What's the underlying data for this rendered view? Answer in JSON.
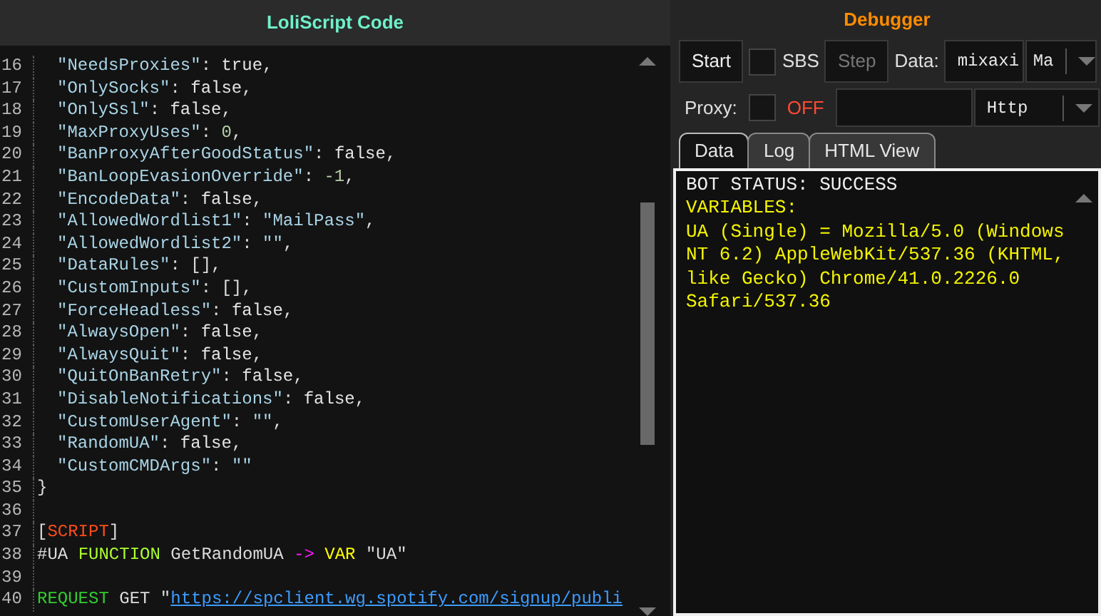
{
  "editor": {
    "title": "LoliScript Code",
    "lines": [
      {
        "number": "16",
        "indented": true,
        "tokens": [
          {
            "kind": "key",
            "text": "\"NeedsProxies\""
          },
          {
            "kind": "punct",
            "text": ": "
          },
          {
            "kind": "bool",
            "text": "true"
          },
          {
            "kind": "punct",
            "text": ","
          }
        ]
      },
      {
        "number": "17",
        "indented": true,
        "tokens": [
          {
            "kind": "key",
            "text": "\"OnlySocks\""
          },
          {
            "kind": "punct",
            "text": ": "
          },
          {
            "kind": "bool",
            "text": "false"
          },
          {
            "kind": "punct",
            "text": ","
          }
        ]
      },
      {
        "number": "18",
        "indented": true,
        "tokens": [
          {
            "kind": "key",
            "text": "\"OnlySsl\""
          },
          {
            "kind": "punct",
            "text": ": "
          },
          {
            "kind": "bool",
            "text": "false"
          },
          {
            "kind": "punct",
            "text": ","
          }
        ]
      },
      {
        "number": "19",
        "indented": true,
        "tokens": [
          {
            "kind": "key",
            "text": "\"MaxProxyUses\""
          },
          {
            "kind": "punct",
            "text": ": "
          },
          {
            "kind": "number",
            "text": "0"
          },
          {
            "kind": "punct",
            "text": ","
          }
        ]
      },
      {
        "number": "20",
        "indented": true,
        "tokens": [
          {
            "kind": "key",
            "text": "\"BanProxyAfterGoodStatus\""
          },
          {
            "kind": "punct",
            "text": ": "
          },
          {
            "kind": "bool",
            "text": "false"
          },
          {
            "kind": "punct",
            "text": ","
          }
        ]
      },
      {
        "number": "21",
        "indented": true,
        "tokens": [
          {
            "kind": "key",
            "text": "\"BanLoopEvasionOverride\""
          },
          {
            "kind": "punct",
            "text": ": "
          },
          {
            "kind": "number",
            "text": "-1"
          },
          {
            "kind": "punct",
            "text": ","
          }
        ]
      },
      {
        "number": "22",
        "indented": true,
        "tokens": [
          {
            "kind": "key",
            "text": "\"EncodeData\""
          },
          {
            "kind": "punct",
            "text": ": "
          },
          {
            "kind": "bool",
            "text": "false"
          },
          {
            "kind": "punct",
            "text": ","
          }
        ]
      },
      {
        "number": "23",
        "indented": true,
        "tokens": [
          {
            "kind": "key",
            "text": "\"AllowedWordlist1\""
          },
          {
            "kind": "punct",
            "text": ": "
          },
          {
            "kind": "key",
            "text": "\"MailPass\""
          },
          {
            "kind": "punct",
            "text": ","
          }
        ]
      },
      {
        "number": "24",
        "indented": true,
        "tokens": [
          {
            "kind": "key",
            "text": "\"AllowedWordlist2\""
          },
          {
            "kind": "punct",
            "text": ": "
          },
          {
            "kind": "key",
            "text": "\"\""
          },
          {
            "kind": "punct",
            "text": ","
          }
        ]
      },
      {
        "number": "25",
        "indented": true,
        "tokens": [
          {
            "kind": "key",
            "text": "\"DataRules\""
          },
          {
            "kind": "punct",
            "text": ": [],"
          }
        ]
      },
      {
        "number": "26",
        "indented": true,
        "tokens": [
          {
            "kind": "key",
            "text": "\"CustomInputs\""
          },
          {
            "kind": "punct",
            "text": ": [],"
          }
        ]
      },
      {
        "number": "27",
        "indented": true,
        "tokens": [
          {
            "kind": "key",
            "text": "\"ForceHeadless\""
          },
          {
            "kind": "punct",
            "text": ": "
          },
          {
            "kind": "bool",
            "text": "false"
          },
          {
            "kind": "punct",
            "text": ","
          }
        ]
      },
      {
        "number": "28",
        "indented": true,
        "tokens": [
          {
            "kind": "key",
            "text": "\"AlwaysOpen\""
          },
          {
            "kind": "punct",
            "text": ": "
          },
          {
            "kind": "bool",
            "text": "false"
          },
          {
            "kind": "punct",
            "text": ","
          }
        ]
      },
      {
        "number": "29",
        "indented": true,
        "tokens": [
          {
            "kind": "key",
            "text": "\"AlwaysQuit\""
          },
          {
            "kind": "punct",
            "text": ": "
          },
          {
            "kind": "bool",
            "text": "false"
          },
          {
            "kind": "punct",
            "text": ","
          }
        ]
      },
      {
        "number": "30",
        "indented": true,
        "tokens": [
          {
            "kind": "key",
            "text": "\"QuitOnBanRetry\""
          },
          {
            "kind": "punct",
            "text": ": "
          },
          {
            "kind": "bool",
            "text": "false"
          },
          {
            "kind": "punct",
            "text": ","
          }
        ]
      },
      {
        "number": "31",
        "indented": true,
        "tokens": [
          {
            "kind": "key",
            "text": "\"DisableNotifications\""
          },
          {
            "kind": "punct",
            "text": ": "
          },
          {
            "kind": "bool",
            "text": "false"
          },
          {
            "kind": "punct",
            "text": ","
          }
        ]
      },
      {
        "number": "32",
        "indented": true,
        "tokens": [
          {
            "kind": "key",
            "text": "\"CustomUserAgent\""
          },
          {
            "kind": "punct",
            "text": ": "
          },
          {
            "kind": "key",
            "text": "\"\""
          },
          {
            "kind": "punct",
            "text": ","
          }
        ]
      },
      {
        "number": "33",
        "indented": true,
        "tokens": [
          {
            "kind": "key",
            "text": "\"RandomUA\""
          },
          {
            "kind": "punct",
            "text": ": "
          },
          {
            "kind": "bool",
            "text": "false"
          },
          {
            "kind": "punct",
            "text": ","
          }
        ]
      },
      {
        "number": "34",
        "indented": true,
        "tokens": [
          {
            "kind": "key",
            "text": "\"CustomCMDArgs\""
          },
          {
            "kind": "punct",
            "text": ": "
          },
          {
            "kind": "key",
            "text": "\"\""
          }
        ]
      },
      {
        "number": "35",
        "indented": false,
        "tokens": [
          {
            "kind": "punct",
            "text": "}"
          }
        ]
      },
      {
        "number": "36",
        "indented": false
      },
      {
        "number": "37",
        "indented": false,
        "tokens": [
          {
            "kind": "punct",
            "text": "["
          },
          {
            "kind": "section",
            "text": "SCRIPT"
          },
          {
            "kind": "punct",
            "text": "]"
          }
        ]
      },
      {
        "number": "38",
        "indented": false,
        "tokens": [
          {
            "kind": "punct",
            "text": "#UA "
          },
          {
            "kind": "keyword",
            "text": "FUNCTION"
          },
          {
            "kind": "punct",
            "text": " GetRandomUA "
          },
          {
            "kind": "arrow",
            "text": "-> "
          },
          {
            "kind": "var",
            "text": "VAR"
          },
          {
            "kind": "punct",
            "text": " \"UA\""
          }
        ]
      },
      {
        "number": "39",
        "indented": false
      },
      {
        "number": "40",
        "indented": false,
        "tokens": [
          {
            "kind": "command",
            "text": "REQUEST"
          },
          {
            "kind": "punct",
            "text": " GET \""
          },
          {
            "kind": "url",
            "text": "https://spclient.wg.spotify.com/signup/publi"
          }
        ]
      }
    ]
  },
  "debugger": {
    "title": "Debugger",
    "start_button": "Start",
    "sbs": {
      "label": "SBS",
      "checked": false
    },
    "step_button": {
      "label": "Step",
      "disabled": true
    },
    "data_label": "Data:",
    "data_value": "mixaxi",
    "data_type": "Ma",
    "proxy": {
      "label": "Proxy:",
      "checked": false,
      "status": "OFF"
    },
    "proxy_type": "Http",
    "tabs": [
      {
        "label": "Data",
        "selected": true
      },
      {
        "label": "Log",
        "selected": false
      },
      {
        "label": "HTML View",
        "selected": false
      }
    ],
    "output": [
      {
        "kind": "status",
        "text": "BOT STATUS: SUCCESS"
      },
      {
        "kind": "variable",
        "text": "VARIABLES:"
      },
      {
        "kind": "variable",
        "text": "UA (Single) = Mozilla/5.0 (Windows NT 6.2) AppleWebKit/537.36 (KHTML, like Gecko) Chrome/41.0.2226.0 Safari/537.36"
      }
    ]
  }
}
